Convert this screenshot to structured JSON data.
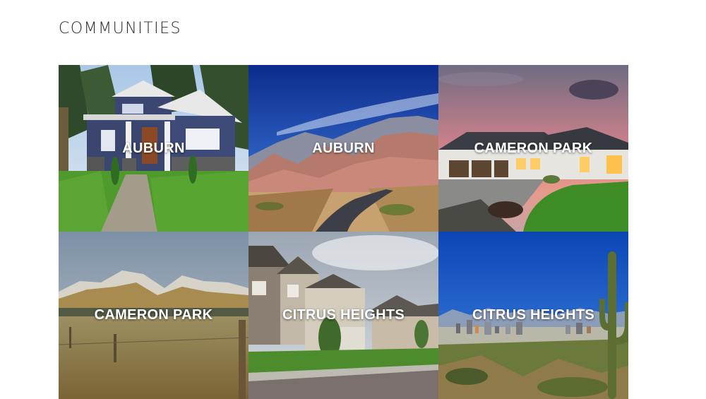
{
  "page": {
    "title": "COMMUNITIES"
  },
  "communities": [
    {
      "label": "AUBURN",
      "image": "craftsman-house-photo"
    },
    {
      "label": "AUBURN",
      "image": "desert-canyon-road-photo"
    },
    {
      "label": "CAMERON PARK",
      "image": "luxury-home-dusk-photo"
    },
    {
      "label": "CAMERON PARK",
      "image": "snowy-mountains-prairie-photo"
    },
    {
      "label": "CITRUS HEIGHTS",
      "image": "suburban-street-homes-photo"
    },
    {
      "label": "CITRUS HEIGHTS",
      "image": "desert-city-skyline-saguaro-photo"
    }
  ]
}
